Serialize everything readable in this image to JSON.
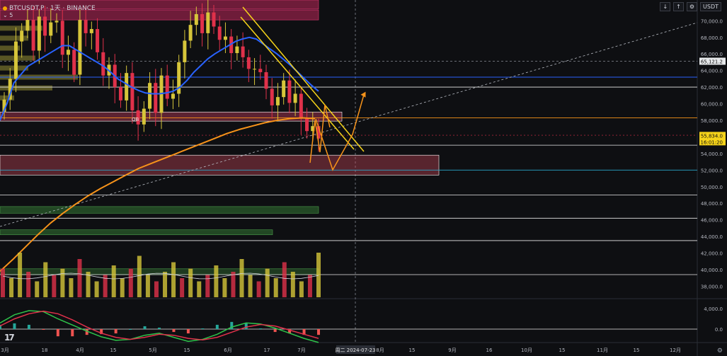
{
  "header": {
    "symbol": "BTCUSDT.P · 1天 · BINANCE",
    "indicator_count": "5",
    "currency": "USDT"
  },
  "colors": {
    "background": "#0e0f12",
    "up": "#d6c53a",
    "down": "#e0314a",
    "ma_blue": "#2962ff",
    "ma_orange": "#f7931a",
    "trend_yellow": "#f5d31a"
  },
  "chart_data": [
    {
      "type": "candlestick",
      "title": "",
      "y_axis_ticks": [
        38000,
        40000,
        42000,
        44000,
        46000,
        48000,
        50000,
        52000,
        54000,
        56000,
        58000,
        60000,
        62000,
        64000,
        66000,
        68000,
        70000
      ],
      "ylim": [
        36500,
        72500
      ],
      "x_ticks": [
        "3月",
        "18",
        "4月",
        "15",
        "5月",
        "15",
        "6月",
        "17",
        "7月",
        "8月",
        "15",
        "9月",
        "16",
        "10月",
        "15",
        "11月",
        "15",
        "12月",
        "15"
      ],
      "price_labels": {
        "dashed_high": "65,121.2",
        "last_price": "55,834.0",
        "countdown": "16:01:20"
      },
      "crosshair_date": "周二 2024-07-23",
      "zone_label": "OB",
      "horizontal_levels": [
        62000,
        58300,
        55000,
        52000,
        49000,
        46200,
        43500,
        39400
      ],
      "close_series": [
        60500,
        63000,
        67500,
        68800,
        70100,
        66400,
        70500,
        68200,
        69800,
        70000,
        65900,
        66500,
        63500,
        70100,
        68500,
        69000,
        66200,
        63400,
        64700,
        62000,
        60400,
        63700,
        59200,
        57500,
        59400,
        62500,
        58900,
        63400,
        60600,
        61200,
        65000,
        67600,
        69500,
        70800,
        68500,
        71000,
        69300,
        67700,
        68100,
        66100,
        66900,
        65600,
        64200,
        64200,
        63800,
        61800,
        59800,
        60800,
        62800,
        60100,
        61200,
        58200,
        56700,
        57300,
        55800
      ],
      "ma_blue": [
        58000,
        60000,
        62500,
        63500,
        64500,
        65000,
        65500,
        66000,
        66500,
        67000,
        67000,
        66500,
        66000,
        65500,
        65000,
        64500,
        63800,
        63000,
        62500,
        62000,
        61600,
        61300,
        61200,
        61200,
        61300,
        61500,
        62000,
        62800,
        63800,
        64600,
        65400,
        66000,
        66500,
        67000,
        67500,
        67800,
        68000,
        67800,
        67200,
        66600,
        66000,
        65300,
        64600,
        63800,
        63000,
        62200,
        61500
      ],
      "ma_orange": [
        39800,
        41200,
        42700,
        44200,
        45600,
        46800,
        47900,
        48900,
        49800,
        50600,
        51400,
        52200,
        52800,
        53400,
        54000,
        54600,
        55200,
        55800,
        56400,
        56900,
        57300,
        57700,
        58000,
        58200,
        58300,
        58200
      ],
      "volume": [
        {
          "label": "",
          "value": 0.9
        },
        {
          "label": "",
          "value": 0.6
        },
        {
          "label": "",
          "value": 1.4
        },
        {
          "label": "",
          "value": 0.8
        },
        {
          "label": "",
          "value": 0.5
        },
        {
          "label": "",
          "value": 1.1
        },
        {
          "label": "",
          "value": 0.7
        },
        {
          "label": "",
          "value": 0.9
        },
        {
          "label": "",
          "value": 0.6
        },
        {
          "label": "",
          "value": 1.2
        },
        {
          "label": "",
          "value": 0.8
        },
        {
          "label": "",
          "value": 0.5
        },
        {
          "label": "",
          "value": 0.7
        },
        {
          "label": "",
          "value": 1.0
        },
        {
          "label": "",
          "value": 0.6
        },
        {
          "label": "",
          "value": 0.9
        },
        {
          "label": "",
          "value": 1.3
        },
        {
          "label": "",
          "value": 0.7
        },
        {
          "label": "",
          "value": 0.5
        },
        {
          "label": "",
          "value": 0.8
        },
        {
          "label": "",
          "value": 1.1
        },
        {
          "label": "",
          "value": 0.6
        },
        {
          "label": "",
          "value": 0.9
        },
        {
          "label": "",
          "value": 0.5
        },
        {
          "label": "",
          "value": 0.7
        },
        {
          "label": "",
          "value": 1.0
        },
        {
          "label": "",
          "value": 0.6
        },
        {
          "label": "",
          "value": 0.8
        },
        {
          "label": "",
          "value": 1.2
        },
        {
          "label": "",
          "value": 0.7
        },
        {
          "label": "",
          "value": 0.5
        },
        {
          "label": "",
          "value": 0.9
        },
        {
          "label": "",
          "value": 0.6
        },
        {
          "label": "",
          "value": 1.1
        },
        {
          "label": "",
          "value": 0.8
        },
        {
          "label": "",
          "value": 0.5
        },
        {
          "label": "",
          "value": 0.7
        },
        {
          "label": "",
          "value": 1.4
        }
      ]
    },
    {
      "type": "line",
      "title": "",
      "y_axis_ticks": [
        "4,000.0",
        "0.0"
      ],
      "series": [
        {
          "values": [
            1.2,
            2.8,
            3.6,
            3.4,
            2.0,
            0.8,
            -0.4,
            -1.5,
            -2.2,
            -2.0,
            -1.2,
            -0.8,
            -1.6,
            -2.4,
            -2.0,
            -1.0,
            0.4,
            1.2,
            1.0,
            0.2,
            -0.8,
            -1.8,
            -2.6
          ]
        },
        {
          "values": [
            0.6,
            2.0,
            3.0,
            3.5,
            3.0,
            1.8,
            0.4,
            -0.8,
            -1.6,
            -2.0,
            -1.6,
            -1.0,
            -1.2,
            -1.8,
            -2.1,
            -1.6,
            -0.6,
            0.4,
            0.9,
            0.6,
            -0.2,
            -1.0,
            -1.8
          ]
        }
      ]
    }
  ]
}
